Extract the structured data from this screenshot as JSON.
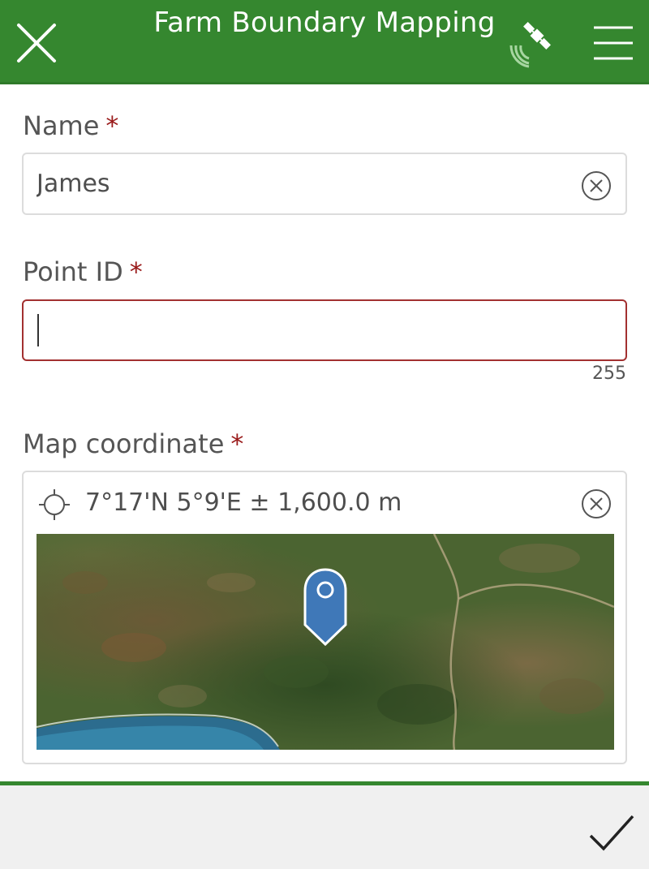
{
  "header": {
    "title": "Farm Boundary Mapping",
    "close_icon": "close-icon",
    "gps_icon": "satellite-icon",
    "menu_icon": "menu-icon"
  },
  "form": {
    "name": {
      "label": "Name",
      "required_mark": "*",
      "value": "James"
    },
    "point_id": {
      "label": "Point ID",
      "required_mark": "*",
      "value": "",
      "counter": "255"
    },
    "map_coordinate": {
      "label": "Map coordinate",
      "required_mark": "*",
      "value": "7°17'N 5°9'E ± 1,600.0 m"
    }
  },
  "footer": {
    "submit_icon": "checkmark-icon"
  },
  "colors": {
    "header_green": "#35872f",
    "required_red": "#9a1b1b",
    "error_border": "#a23030",
    "pin_blue": "#3f78b8"
  }
}
